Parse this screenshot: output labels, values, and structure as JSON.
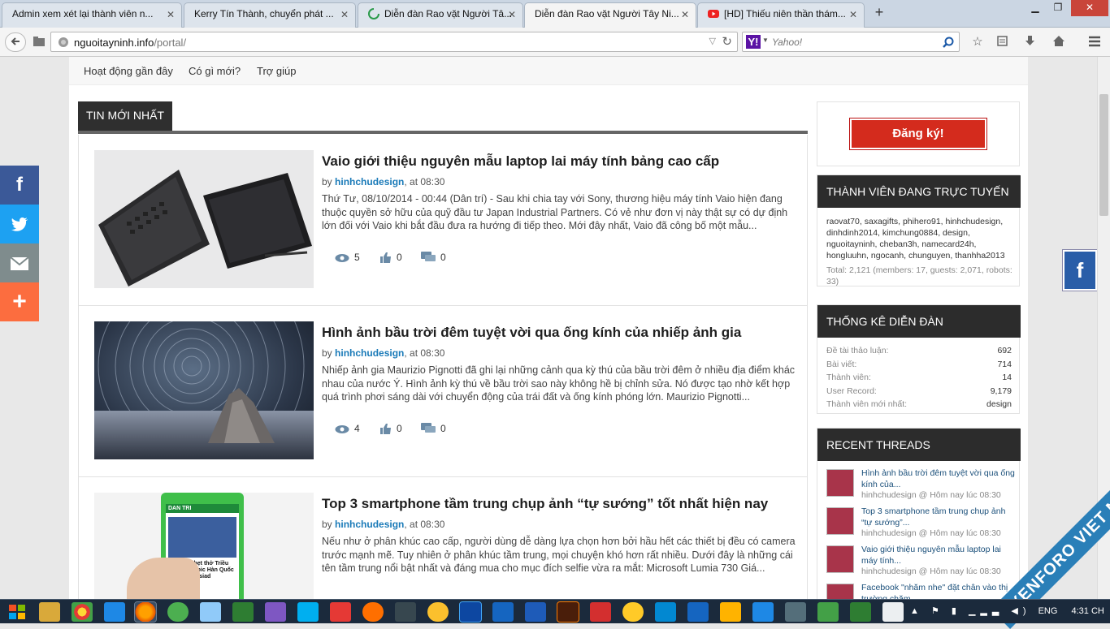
{
  "browser": {
    "tabs": [
      {
        "label": "Admin xem xét lại thành viên n...",
        "active": false
      },
      {
        "label": "Kerry Tín Thành, chuyển phát ...",
        "active": false
      },
      {
        "label": "Diễn đàn Rao vặt Người Tâ...",
        "active": false
      },
      {
        "label": "Diễn đàn Rao vặt Người Tây Ni...",
        "active": true
      },
      {
        "label": "[HD] Thiếu niên thần thám...",
        "active": false
      }
    ],
    "new_tab_label": "+",
    "url_domain": "nguoitayninh.info",
    "url_path": "/portal/",
    "search_placeholder": "Yahoo!",
    "search_engine_logo": "Y!"
  },
  "subnav": {
    "items": [
      "Hoạt động gần đây",
      "Có gì mới?",
      "Trợ giúp"
    ]
  },
  "section_title": "TIN MỚI NHẤT",
  "articles": [
    {
      "title": "Vaio giới thiệu nguyên mẫu laptop lai máy tính bảng cao cấp",
      "by_label": "by",
      "author": "hinhchudesign",
      "time": ", at 08:30",
      "excerpt": "Thứ Tư, 08/10/2014 - 00:44 (Dân trí) - Sau khi chia tay với Sony, thương hiệu máy tính Vaio hiện đang thuộc quyền sở hữu của quỹ đầu tư Japan Industrial Partners. Có vẻ như đơn vị này thật sự có dự định lớn đối với Vaio khi bắt đầu đưa ra hướng đi tiếp theo. Mới đây nhất, Vaio đã công bố một mẫu...",
      "views": "5",
      "likes": "0",
      "comments": "0"
    },
    {
      "title": "Hình ảnh bầu trời đêm tuyệt vời qua ống kính của nhiếp ảnh gia",
      "by_label": "by",
      "author": "hinhchudesign",
      "time": ", at 08:30",
      "excerpt": "Nhiếp ảnh gia Maurizio Pignotti đã ghi lại những cảnh qua kỳ thú của bầu trời đêm ở nhiều địa điểm khác nhau của nước Ý. Hình ảnh kỳ thú về bầu trời sao này không hề bị chỉnh sửa. Nó được tạo nhờ kết hợp quá trình phơi sáng dài với chuyển động của trái đất và ống kính phóng lớn. Maurizio Pignotti...",
      "views": "4",
      "likes": "0",
      "comments": "0"
    },
    {
      "title": "Top 3 smartphone tầm trung chụp ảnh “tự sướng” tốt nhất hiện nay",
      "by_label": "by",
      "author": "hinhchudesign",
      "time": ", at 08:30",
      "excerpt": "Nếu như ở phân khúc cao cấp, người dùng dễ dàng lựa chọn hơn bởi hầu hết các thiết bị đều có camera trước mạnh mẽ. Tuy nhiên ở phân khúc tầm trung, mọi chuyện khó hơn rất nhiều. Dưới đây là những cái tên tầm trung nổi bật nhất và đáng mua cho mục đích selfie vừa ra mắt: Microsoft Lumia 730 Giá...",
      "views": "",
      "likes": "",
      "comments": ""
    }
  ],
  "phone_screen": {
    "brand": "DAN TRI",
    "headline": "Thắng nghẹt thở Triều Tiên, Olympic Hàn Quốc đoạt HCV Asiad"
  },
  "sidebar": {
    "register_button": "Đăng ký!",
    "online": {
      "title": "THÀNH VIÊN ĐANG TRỰC TUYẾN",
      "members": "raovat70, saxagifts, phihero91, hinhchudesign, dinhdinh2014, kimchung0884, design, nguoitayninh, cheban3h, namecard24h, hongluuhn, ngocanh, chunguyen, thanhha2013",
      "totals": "Total: 2,121 (members: 17, guests: 2,071, robots: 33)"
    },
    "stats": {
      "title": "THỐNG KÊ DIỄN ĐÀN",
      "rows": [
        {
          "label": "Đề tài thảo luận:",
          "value": "692"
        },
        {
          "label": "Bài viết:",
          "value": "714"
        },
        {
          "label": "Thành viên:",
          "value": "14"
        },
        {
          "label": "User Record:",
          "value": "9,179"
        },
        {
          "label": "Thành viên mới nhất:",
          "value": "design"
        }
      ]
    },
    "recent": {
      "title": "RECENT THREADS",
      "items": [
        {
          "title": "Hình ảnh bầu trời đêm tuyệt vời qua ống kính của...",
          "by": "hinhchudesign @ Hôm nay lúc 08:30"
        },
        {
          "title": "Top 3 smartphone tầm trung chụp ảnh “tự sướng”...",
          "by": "hinhchudesign @ Hôm nay lúc 08:30"
        },
        {
          "title": "Vaio giới thiệu nguyên mẫu laptop lai máy tính...",
          "by": "hinhchudesign @ Hôm nay lúc 08:30"
        },
        {
          "title": "Facebook \"nhăm nhe\" đặt chân vào thị trường chăm...",
          "by": ""
        }
      ]
    }
  },
  "share_bar": {
    "colors": [
      "#3b5998",
      "#1da1f2",
      "#7f8c8d",
      "#fc6d3f"
    ],
    "icons": [
      "facebook-icon",
      "twitter-icon",
      "mail-icon",
      "plus-icon"
    ]
  },
  "watermark": "XENFORO VIET NAM",
  "systray": {
    "language": "ENG",
    "time": "4:31 CH"
  }
}
